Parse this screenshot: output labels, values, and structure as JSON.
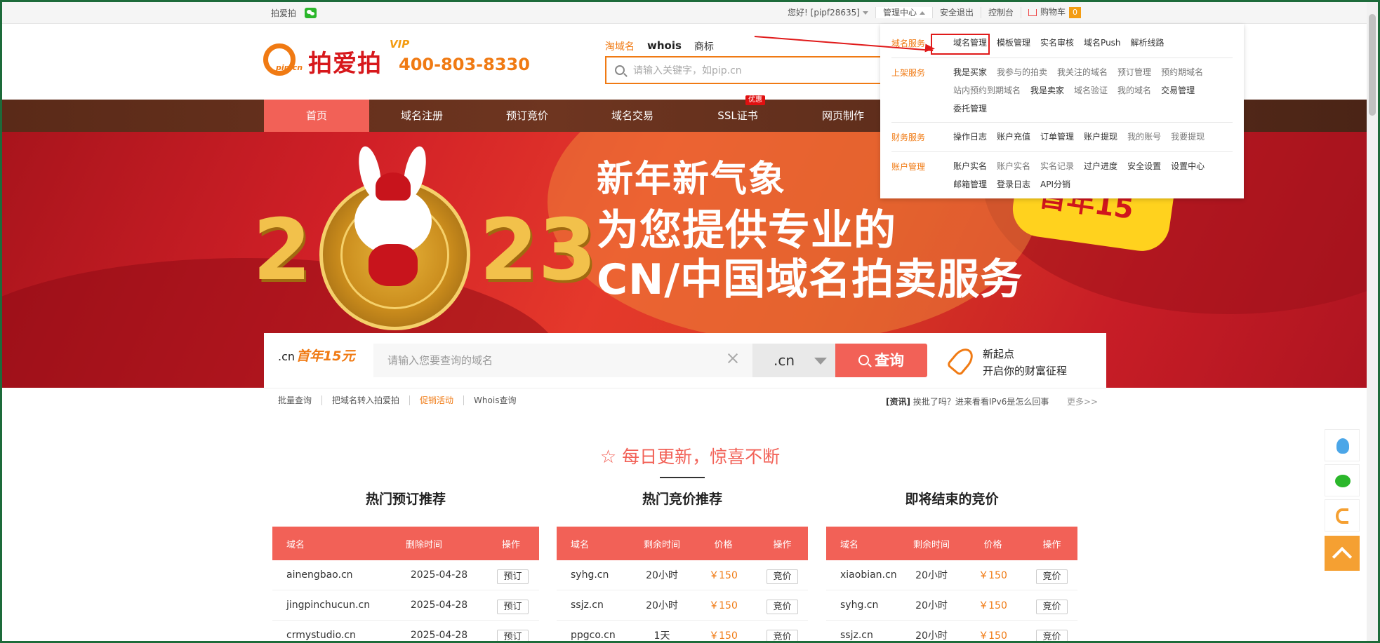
{
  "topbar": {
    "left_text": "拍爱拍",
    "greeting": "您好!",
    "username": "[pipf28635]",
    "management": "管理中心",
    "logout": "安全退出",
    "control": "控制台",
    "cart": "购物车",
    "cart_count": "0"
  },
  "header": {
    "logo_text": "拍爱拍",
    "logo_cn": "pip.cn",
    "vip": "VIP",
    "phone": "400-803-8330",
    "search_tabs": [
      "淘域名",
      "whois",
      "商标"
    ],
    "search_placeholder": "请输入关键字，如pip.cn"
  },
  "nav": {
    "items": [
      "首页",
      "域名注册",
      "预订竞价",
      "域名交易",
      "SSL证书",
      "网页制作"
    ],
    "hot_badge": "优惠"
  },
  "banner": {
    "year_left": "2",
    "year_right": "23",
    "line1": "新年新气象",
    "line2": "为您提供专业的",
    "line3": "CN/中国域名拍卖服务",
    "promo": "首年15"
  },
  "domain_search": {
    "label_prefix": ".cn",
    "label_price": "首年15元",
    "placeholder": "请输入您要查询的域名",
    "suffix": ".cn",
    "button": "查询",
    "slogan1": "新起点",
    "slogan2": "开启你的财富征程"
  },
  "quicklinks": {
    "links": [
      "批量查询",
      "把域名转入拍爱拍",
      "促销活动",
      "Whois查询"
    ],
    "news_tag": "[资讯]",
    "news": "挨批了吗？进来看看IPv6是怎么回事",
    "more": "更多>>"
  },
  "section": {
    "title": "每日更新，惊喜不断",
    "col1_title": "热门预订推荐",
    "col2_title": "热门竞价推荐",
    "col3_title": "即将结束的竞价"
  },
  "table1": {
    "headers": [
      "域名",
      "删除时间",
      "操作"
    ],
    "rows": [
      {
        "domain": "ainengbao.cn",
        "time": "2025-04-28",
        "action": "预订"
      },
      {
        "domain": "jingpinchucun.cn",
        "time": "2025-04-28",
        "action": "预订"
      },
      {
        "domain": "crmystudio.cn",
        "time": "2025-04-28",
        "action": "预订"
      }
    ]
  },
  "table2": {
    "headers": [
      "域名",
      "剩余时间",
      "价格",
      "操作"
    ],
    "rows": [
      {
        "domain": "syhg.cn",
        "time": "20小时",
        "price": "￥150",
        "action": "竞价"
      },
      {
        "domain": "ssjz.cn",
        "time": "20小时",
        "price": "￥150",
        "action": "竞价"
      },
      {
        "domain": "ppgco.cn",
        "time": "1天",
        "price": "￥150",
        "action": "竞价"
      }
    ]
  },
  "table3": {
    "headers": [
      "域名",
      "剩余时间",
      "价格",
      "操作"
    ],
    "rows": [
      {
        "domain": "xiaobian.cn",
        "time": "20小时",
        "price": "￥150",
        "action": "竞价"
      },
      {
        "domain": "syhg.cn",
        "time": "20小时",
        "price": "￥150",
        "action": "竞价"
      },
      {
        "domain": "ssjz.cn",
        "time": "20小时",
        "price": "￥150",
        "action": "竞价"
      }
    ]
  },
  "dropdown": {
    "groups": [
      {
        "cat": "域名服务",
        "items": [
          "域名管理",
          "模板管理",
          "实名审核",
          "域名Push",
          "解析线路"
        ]
      },
      {
        "cat": "上架服务",
        "items": [
          "我是买家",
          "我参与的拍卖",
          "我关注的域名",
          "预订管理",
          "预约期域名",
          "站内预约到期域名",
          "我是卖家",
          "域名验证",
          "我的域名",
          "交易管理",
          "委托管理"
        ]
      },
      {
        "cat": "财务服务",
        "items": [
          "操作日志",
          "账户充值",
          "订单管理",
          "账户提现",
          "我的账号",
          "我要提现"
        ]
      },
      {
        "cat": "账户管理",
        "items": [
          "账户实名",
          "账户实名",
          "实名记录",
          "过户进度",
          "安全设置",
          "设置中心",
          "邮箱管理",
          "登录日志",
          "API分销"
        ]
      }
    ]
  },
  "colors": {
    "accent": "#f26157",
    "orange": "#f07a13",
    "nav_bg": "#5a2a18"
  }
}
